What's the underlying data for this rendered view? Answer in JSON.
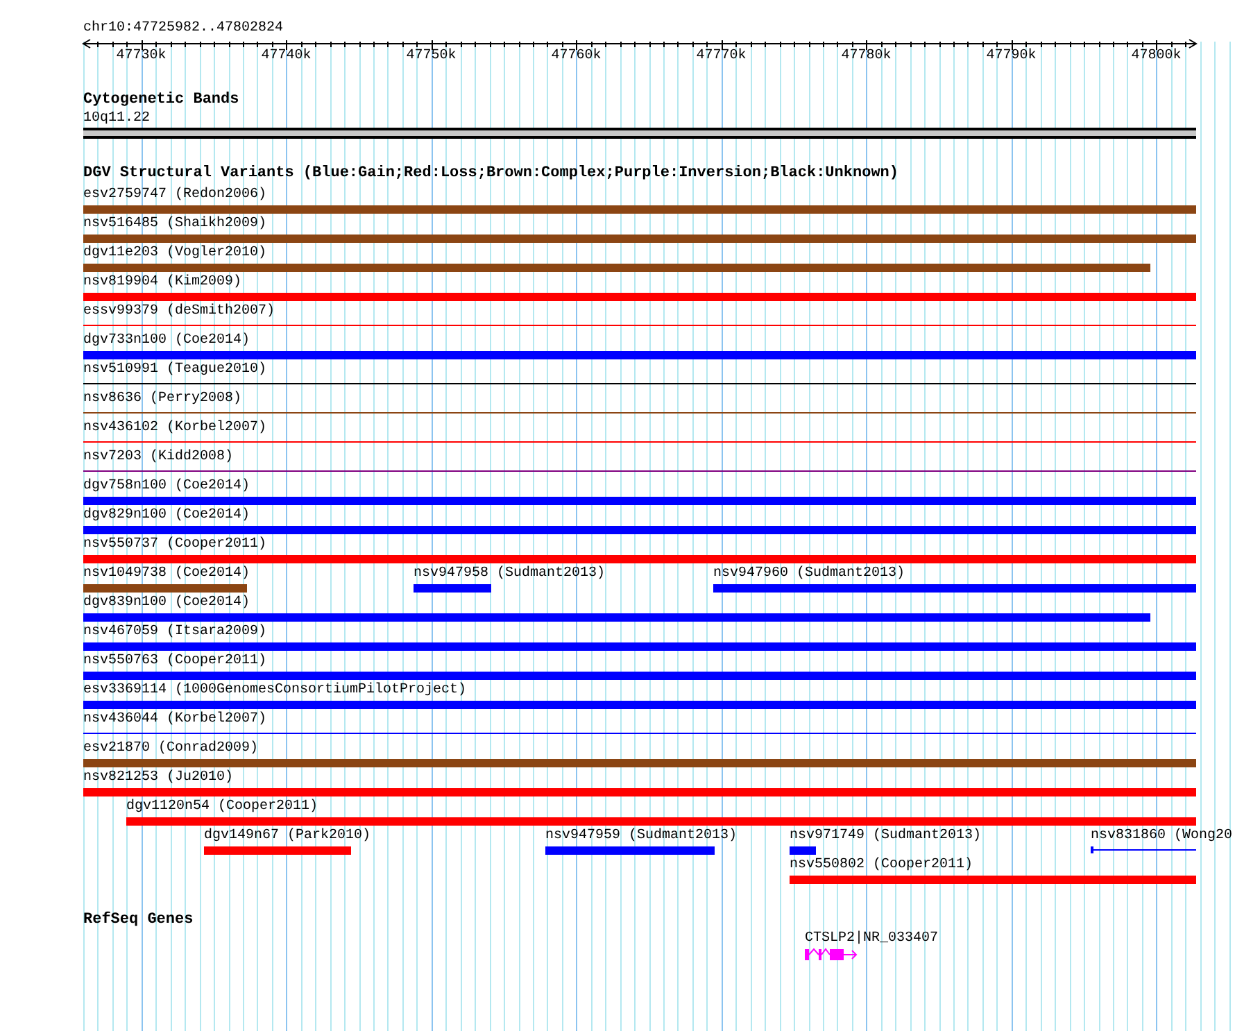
{
  "position": "chr10:47725982..47802824",
  "ruler": {
    "ticks": [
      "47730k",
      "47740k",
      "47750k",
      "47760k",
      "47770k",
      "47780k",
      "47790k",
      "47800k"
    ]
  },
  "cytogenetic_bands": {
    "title": "Cytogenetic Bands",
    "band": "10q11.22"
  },
  "structural_variants": {
    "title": "DGV Structural Variants (Blue:Gain;Red:Loss;Brown:Complex;Purple:Inversion;Black:Unknown)",
    "rows": [
      {
        "features": [
          {
            "label": "esv2759747 (Redon2006)",
            "color": "#8b4513",
            "kind": "thick"
          }
        ]
      },
      {
        "features": [
          {
            "label": "nsv516485 (Shaikh2009)",
            "color": "#8b4513",
            "kind": "thick"
          }
        ]
      },
      {
        "features": [
          {
            "label": "dgv11e203 (Vogler2010)",
            "color": "#8b4513",
            "kind": "thick"
          }
        ]
      },
      {
        "features": [
          {
            "label": "nsv819904 (Kim2009)",
            "color": "#ff0000",
            "kind": "thick"
          }
        ]
      },
      {
        "features": [
          {
            "label": "essv99379 (deSmith2007)",
            "color": "#ff0000",
            "kind": "thin"
          }
        ]
      },
      {
        "features": [
          {
            "label": "dgv733n100 (Coe2014)",
            "color": "#0000ff",
            "kind": "thick"
          }
        ]
      },
      {
        "features": [
          {
            "label": "nsv510991 (Teague2010)",
            "color": "#000000",
            "kind": "thin"
          }
        ]
      },
      {
        "features": [
          {
            "label": "nsv8636 (Perry2008)",
            "color": "#8b4513",
            "kind": "thin"
          }
        ]
      },
      {
        "features": [
          {
            "label": "nsv436102 (Korbel2007)",
            "color": "#ff0000",
            "kind": "thin"
          }
        ]
      },
      {
        "features": [
          {
            "label": "nsv7203 (Kidd2008)",
            "color": "#800080",
            "kind": "thin"
          }
        ]
      },
      {
        "features": [
          {
            "label": "dgv758n100 (Coe2014)",
            "color": "#0000ff",
            "kind": "thick"
          }
        ]
      },
      {
        "features": [
          {
            "label": "dgv829n100 (Coe2014)",
            "color": "#0000ff",
            "kind": "thick"
          }
        ]
      },
      {
        "features": [
          {
            "label": "nsv550737 (Cooper2011)",
            "color": "#ff0000",
            "kind": "thick"
          }
        ]
      },
      {
        "features": [
          {
            "label": "nsv1049738 (Coe2014)",
            "color": "#8b4513",
            "kind": "thick"
          },
          {
            "label": "nsv947958 (Sudmant2013)",
            "color": "#0000ff",
            "kind": "thick"
          },
          {
            "label": "nsv947960 (Sudmant2013)",
            "color": "#0000ff",
            "kind": "thick"
          }
        ]
      },
      {
        "features": [
          {
            "label": "dgv839n100 (Coe2014)",
            "color": "#0000ff",
            "kind": "thick"
          }
        ]
      },
      {
        "features": [
          {
            "label": "nsv467059 (Itsara2009)",
            "color": "#0000ff",
            "kind": "thick"
          }
        ]
      },
      {
        "features": [
          {
            "label": "nsv550763 (Cooper2011)",
            "color": "#0000ff",
            "kind": "thick"
          }
        ]
      },
      {
        "features": [
          {
            "label": "esv3369114 (1000GenomesConsortiumPilotProject)",
            "color": "#0000ff",
            "kind": "thick"
          }
        ]
      },
      {
        "features": [
          {
            "label": "nsv436044 (Korbel2007)",
            "color": "#0000ff",
            "kind": "thin"
          }
        ]
      },
      {
        "features": [
          {
            "label": "esv21870 (Conrad2009)",
            "color": "#8b4513",
            "kind": "thick"
          }
        ]
      },
      {
        "features": [
          {
            "label": "nsv821253 (Ju2010)",
            "color": "#ff0000",
            "kind": "thick"
          }
        ]
      },
      {
        "features": [
          {
            "label": "dgv1120n54 (Cooper2011)",
            "color": "#ff0000",
            "kind": "thick"
          }
        ]
      },
      {
        "features": [
          {
            "label": "dgv149n67 (Park2010)",
            "color": "#ff0000",
            "kind": "thick"
          },
          {
            "label": "nsv947959 (Sudmant2013)",
            "color": "#0000ff",
            "kind": "thick"
          },
          {
            "label": "nsv971749 (Sudmant2013)",
            "color": "#0000ff",
            "kind": "thick"
          },
          {
            "label": "nsv831860 (Wong20",
            "color": "#0000ff",
            "kind": "thin"
          }
        ]
      },
      {
        "features": [
          {
            "label": "nsv550802 (Cooper2011)",
            "color": "#ff0000",
            "kind": "thick"
          }
        ]
      }
    ]
  },
  "refseq_genes": {
    "title": "RefSeq Genes",
    "genes": [
      {
        "label": "CTSLP2|NR_033407"
      }
    ]
  }
}
